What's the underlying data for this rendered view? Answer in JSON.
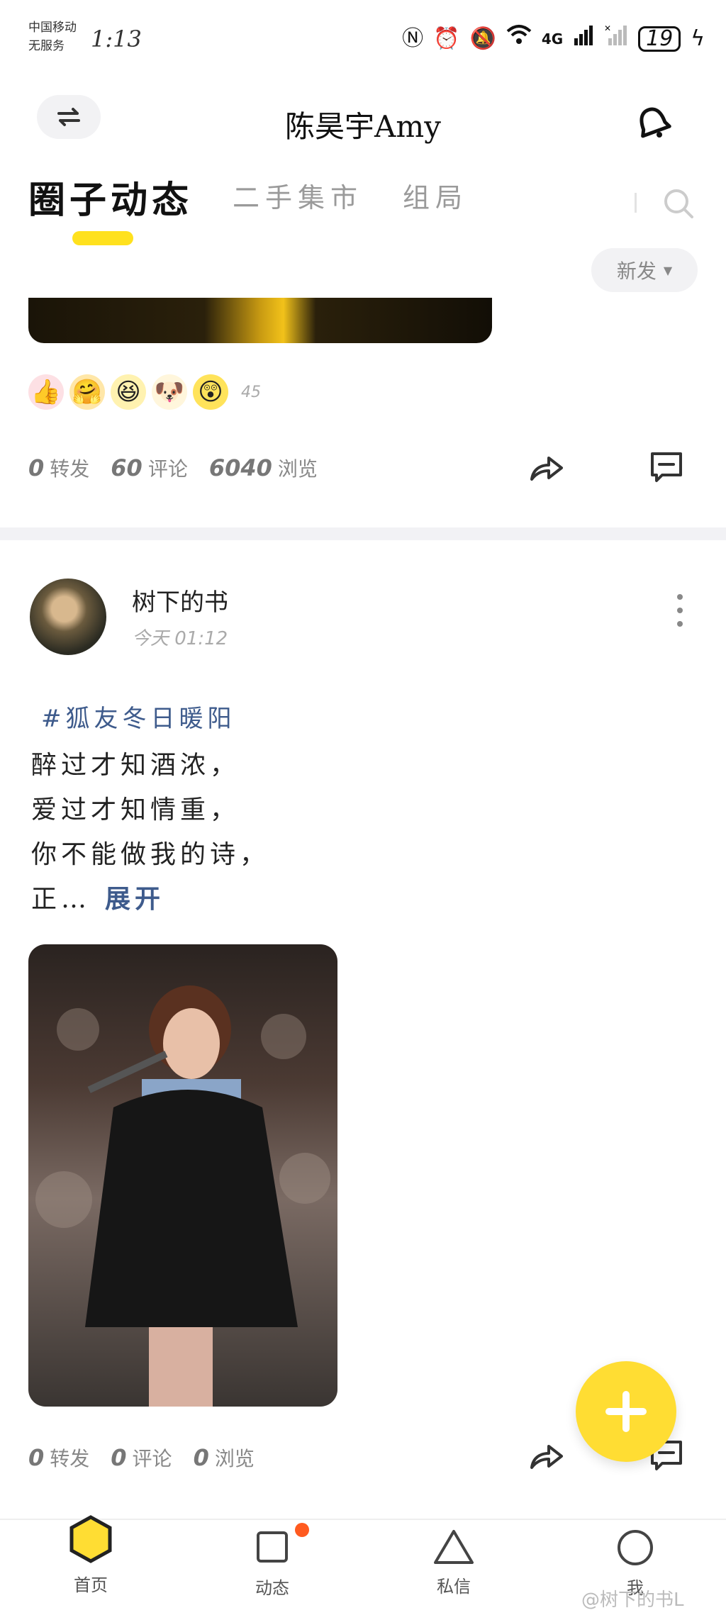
{
  "status_bar": {
    "carrier_line1": "中国移动",
    "carrier_line2": "无服务",
    "time": "1:13",
    "network": "4G",
    "battery": "19"
  },
  "header": {
    "title": "陈昊宇Amy"
  },
  "tabs": [
    {
      "label": "圈子动态",
      "active": true
    },
    {
      "label": "二手集市",
      "active": false
    },
    {
      "label": "组局",
      "active": false
    }
  ],
  "sort": {
    "label": "新发"
  },
  "post1": {
    "reactions": [
      "👍",
      "🤗",
      "😆",
      "🐶",
      "😲"
    ],
    "reaction_count": "45",
    "stats": {
      "reposts": "0",
      "reposts_label": "转发",
      "comments": "60",
      "comments_label": "评论",
      "views": "6040",
      "views_label": "浏览"
    }
  },
  "post2": {
    "author": "树下的书",
    "time": "今天 01:12",
    "hashtag": "#狐友冬日暖阳",
    "lines": [
      "醉过才知酒浓，",
      "爱过才知情重，",
      "你不能做我的诗，",
      "正…"
    ],
    "expand_label": "展开",
    "stats": {
      "reposts": "0",
      "reposts_label": "转发",
      "comments": "0",
      "comments_label": "评论",
      "views": "0",
      "views_label": "浏览"
    }
  },
  "nav": [
    {
      "label": "首页"
    },
    {
      "label": "动态"
    },
    {
      "label": "私信"
    },
    {
      "label": "我"
    }
  ],
  "watermark": "@树下的书L",
  "colors": {
    "accent": "#ffdd33",
    "link": "#3e5b8c",
    "badge": "#ff5a1f"
  }
}
